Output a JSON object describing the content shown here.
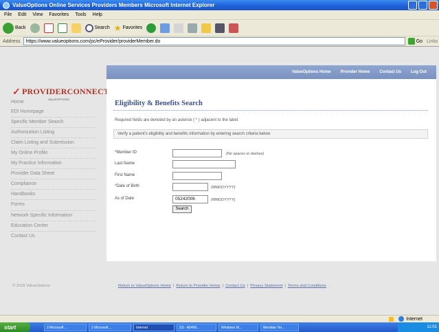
{
  "window": {
    "title": "ValueOptions Online Services   Providers   Members   Microsoft Internet Explorer"
  },
  "menubar": [
    "File",
    "Edit",
    "View",
    "Favorites",
    "Tools",
    "Help"
  ],
  "toolbar": {
    "back_label": "Back",
    "search_label": "Search",
    "favorites_label": "Favorites"
  },
  "addressbar": {
    "label": "Address",
    "url": "https://www.valueoptions.com/pc/eProvider/providerMember.do",
    "go_label": "Go",
    "links_label": "Links"
  },
  "topnav": [
    "ValueOptions Home",
    "Provider Home",
    "Contact Us",
    "Log Out"
  ],
  "logo": {
    "name": "PROVIDERCONNECT",
    "sub": "VALUEOPTIONS"
  },
  "sidebar": [
    "Home",
    "EDI Homepage",
    "Specific Member Search",
    "Authorization Listing",
    "Claim Listing and Submission",
    "My Online Profile",
    "My Practice Information",
    "Provider Data Sheet",
    "Compliance",
    "Handbooks",
    "Forms",
    "Network Specific Information",
    "Education Center",
    "Contact Us"
  ],
  "main": {
    "title": "Eligibility & Benefits Search",
    "required_note_pre": "Required fields are denoted by an asterisk (",
    "required_note_star": " * ",
    "required_note_post": ") adjacent to the label.",
    "info": "Verify a patient's eligibility and benefits information by entering search criteria below.",
    "fields": {
      "member_id": {
        "required_mark": "*",
        "label": "Member ID",
        "value": "",
        "hint": "(No spaces or dashes)"
      },
      "last_name": {
        "label": "Last Name",
        "value": ""
      },
      "first_name": {
        "label": "First Name",
        "value": ""
      },
      "dob": {
        "required_mark": "*",
        "label": "Date of Birth",
        "value": "",
        "hint": "(MMDDYYYY)"
      },
      "as_of_date": {
        "label": "As of Date",
        "value": "05242006",
        "hint": "(MMDDYYYY)"
      }
    },
    "search_label": "Search"
  },
  "footer": {
    "copyright": "© 2005 ValueOptions",
    "links": [
      "Return to ValueOptions Home",
      "Return to Provider Home",
      "Contact Us",
      "Privacy Statement",
      "Terms and Conditions"
    ]
  },
  "statusbar": {
    "zone": "Internet"
  },
  "taskbar": {
    "start": "start",
    "tasks": [
      "3 Microsoft ...",
      "2 Microsoft ...",
      "Internet",
      "SS - A5400...",
      "Windows M...",
      "Meridian Ter..."
    ],
    "clock": "11:01"
  }
}
